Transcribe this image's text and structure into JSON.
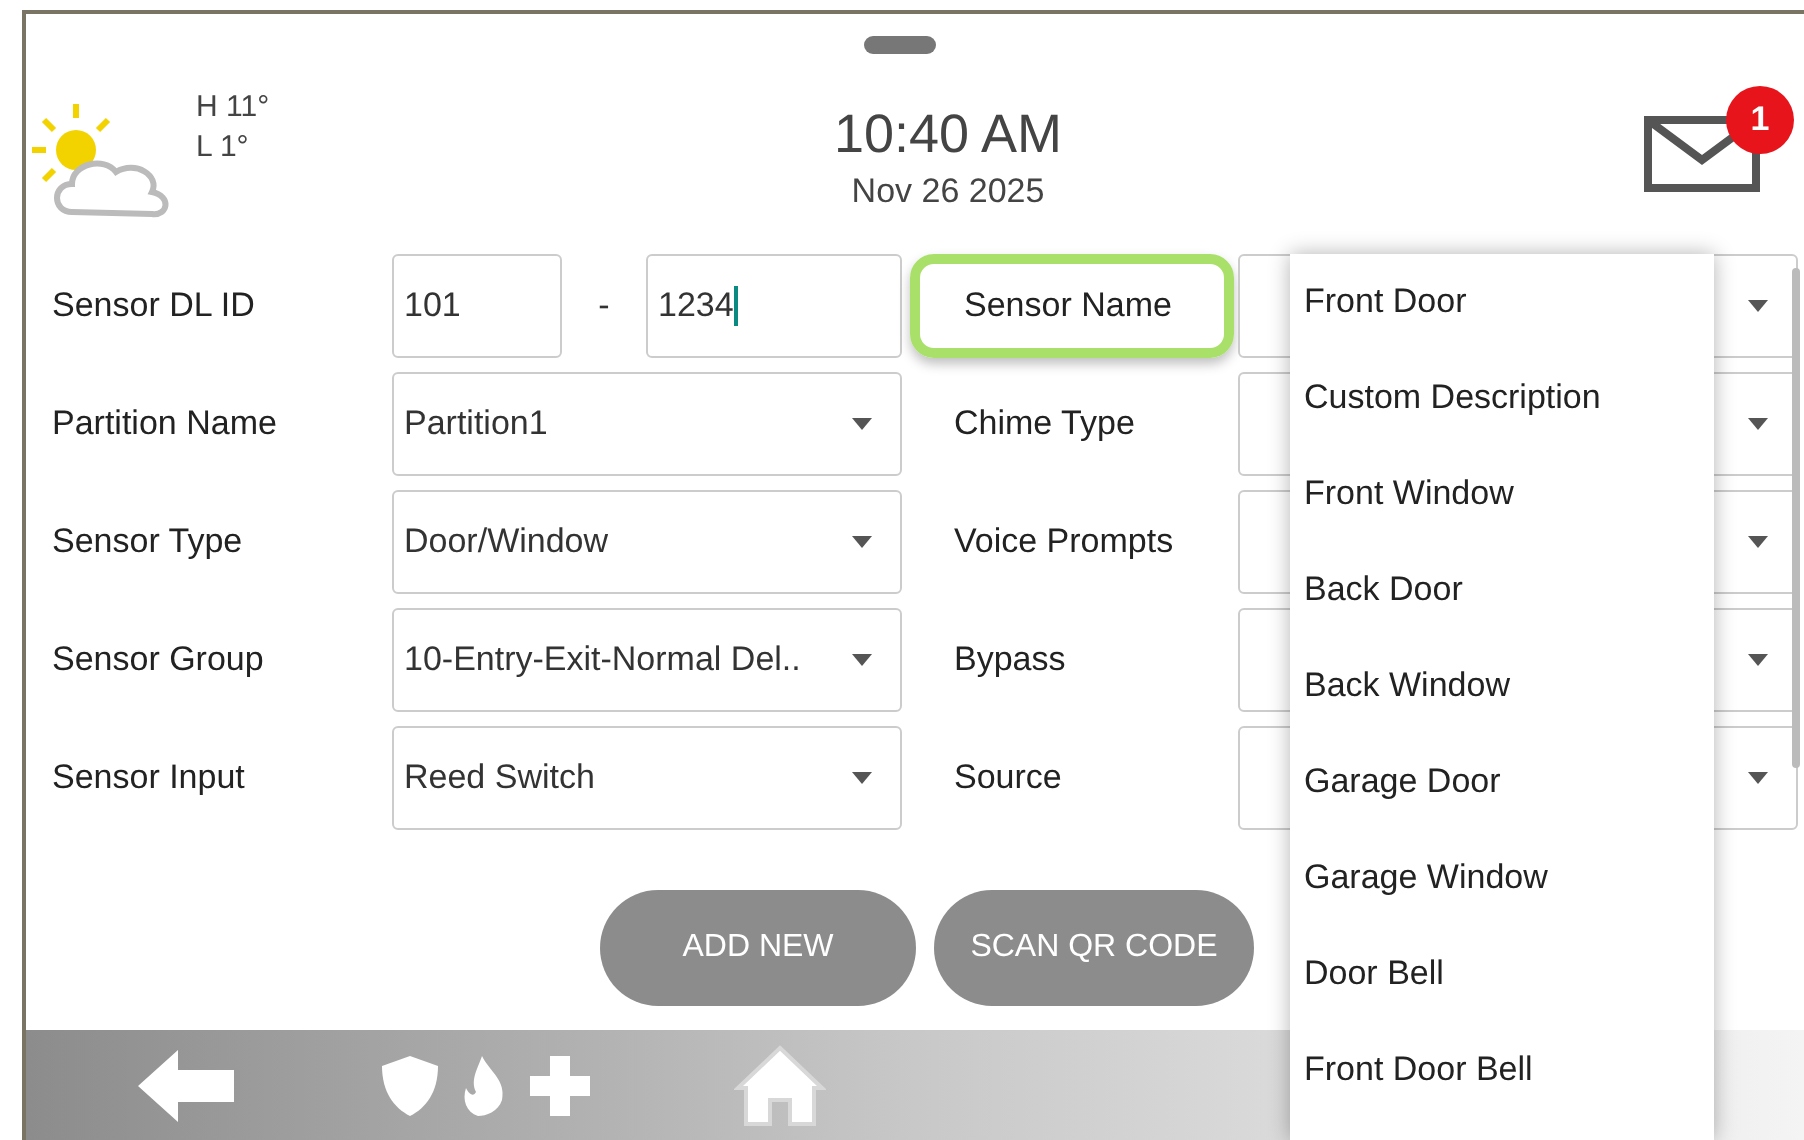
{
  "header": {
    "weather": {
      "high": "H 11°",
      "low": "L 1°"
    },
    "time": "10:40 AM",
    "date": "Nov 26 2025",
    "messages": {
      "count": "1"
    }
  },
  "form": {
    "left": [
      {
        "label": "Sensor DL ID",
        "kind": "id",
        "values": [
          "101",
          "1234"
        ],
        "separator": "-"
      },
      {
        "label": "Partition Name",
        "kind": "select",
        "value": "Partition1"
      },
      {
        "label": "Sensor Type",
        "kind": "select",
        "value": "Door/Window"
      },
      {
        "label": "Sensor Group",
        "kind": "select",
        "value": "10-Entry-Exit-Normal Del.."
      },
      {
        "label": "Sensor Input",
        "kind": "select",
        "value": "Reed Switch"
      }
    ],
    "right": [
      {
        "label": "Sensor Name",
        "selected": true
      },
      {
        "label": "Chime Type",
        "selected": false
      },
      {
        "label": "Voice Prompts",
        "selected": false
      },
      {
        "label": "Bypass",
        "selected": false
      },
      {
        "label": "Source",
        "selected": false
      }
    ]
  },
  "dropdown": {
    "items": [
      "Front Door",
      "Custom Description",
      "Front Window",
      "Back Door",
      "Back Window",
      "Garage Door",
      "Garage Window",
      "Door Bell",
      "Front Door Bell"
    ]
  },
  "buttons": [
    "ADD NEW",
    "SCAN QR CODE"
  ]
}
